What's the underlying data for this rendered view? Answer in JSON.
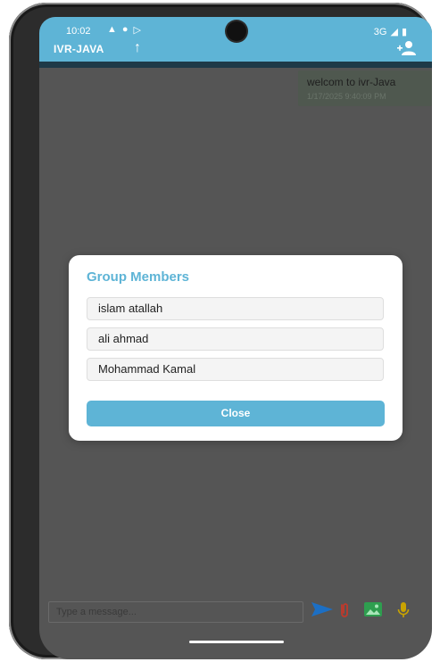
{
  "status_bar": {
    "time": "10:02",
    "network": "3G"
  },
  "app_bar": {
    "title": "IVR-JAVA"
  },
  "message": {
    "text": "welcom to ivr-Java",
    "timestamp": "1/17/2025 9:40:09 PM"
  },
  "dialog": {
    "title": "Group Members",
    "members": [
      "islam atallah",
      "ali ahmad",
      "Mohammad Kamal"
    ],
    "close_label": "Close"
  },
  "composer": {
    "placeholder": "Type a message..."
  },
  "colors": {
    "accent": "#5eb4d6",
    "send": "#1c6fc4",
    "attach": "#c0392b",
    "gallery": "#2e9e4f",
    "mic": "#c9a300"
  },
  "icons": [
    "up-arrow-icon",
    "add-person-icon",
    "send-icon",
    "attach-icon",
    "gallery-icon",
    "mic-icon"
  ]
}
